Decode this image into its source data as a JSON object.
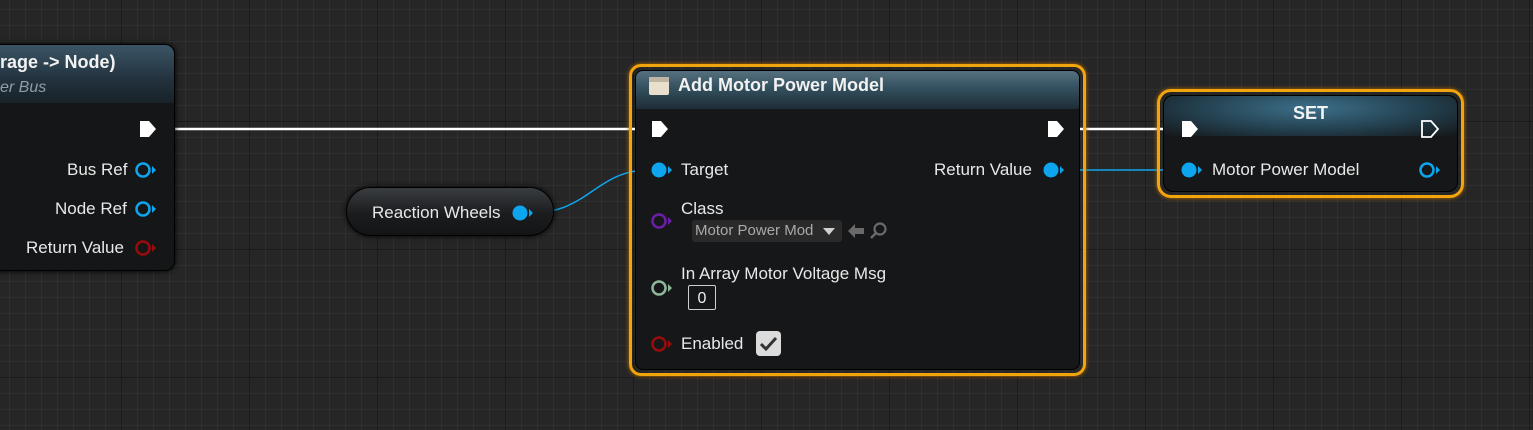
{
  "colors": {
    "exec_wire": "#ffffff",
    "object_pin": "#0ea5ef",
    "class_pin": "#6b1fa8",
    "struct_pin": "#8fb89a",
    "bool_pin": "#9a0c0c",
    "selection": "#f2a40c"
  },
  "left_node": {
    "title": "rage -> Node)",
    "subtitle": "er Bus",
    "pins": [
      "Bus Ref",
      "Node Ref",
      "Return Value"
    ]
  },
  "variable_node": {
    "label": "Reaction Wheels"
  },
  "main_node": {
    "title": "Add Motor Power Model",
    "icon": "function-icon",
    "pins": {
      "target": "Target",
      "return_value": "Return Value",
      "class": "Class",
      "class_value": "Motor Power Mod",
      "in_array": "In Array Motor Voltage Msg",
      "in_array_value": "0",
      "enabled": "Enabled",
      "enabled_checked": true
    }
  },
  "set_node": {
    "title": "SET",
    "pin": "Motor Power Model"
  }
}
